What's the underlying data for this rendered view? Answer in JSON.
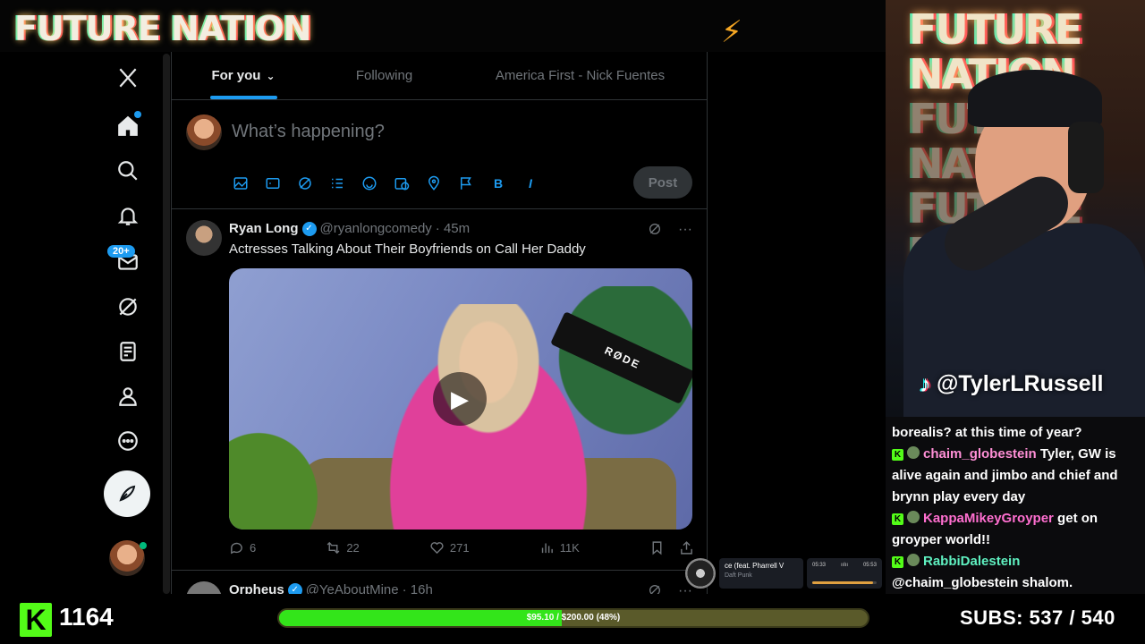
{
  "stream": {
    "brand": "FUTURE NATION",
    "webcam_bg_lines": [
      "FUTURE NATION",
      "FUTURE NATION",
      "FUTURE NATION"
    ],
    "tiktok_handle": "@TylerLRussell",
    "kick_logo": "K",
    "viewer_count": "1164",
    "goal_text": "$95.10 / $200.00 (48%)",
    "goal_progress": 0.48,
    "subs_text": "SUBS:  537 / 540"
  },
  "x_nav": {
    "badge_count": "20+"
  },
  "feed": {
    "tabs": [
      {
        "label": "For you",
        "active": true
      },
      {
        "label": "Following",
        "active": false
      },
      {
        "label": "America First - Nick Fuentes",
        "active": false
      }
    ],
    "composer": {
      "placeholder": "What’s happening?",
      "post_label": "Post",
      "tools": [
        "image",
        "GIF",
        "grok",
        "poll",
        "emoji",
        "schedule",
        "location",
        "flag",
        "B",
        "I"
      ]
    },
    "tweets": [
      {
        "name": "Ryan Long",
        "handle": "@ryanlongcomedy",
        "time": "· 45m",
        "text": "Actresses Talking About Their Boyfriends on Call Her Daddy",
        "media_mic_brand": "RØDE",
        "replies": "6",
        "reposts": "22",
        "likes": "271",
        "views": "11K"
      },
      {
        "name": "Orpheus",
        "handle": "@YeAboutMine",
        "time": "· 16h"
      }
    ]
  },
  "music": {
    "song": "ce (feat. Pharrell V",
    "artist": "Daft Punk",
    "elapsed": "05:33",
    "total": "05:53"
  },
  "chat": [
    {
      "user": "",
      "text": "borealis? at this time of year?"
    },
    {
      "user": "chaim_globestein",
      "text": " Tyler, GW is alive again and jimbo and chief and brynn play every day"
    },
    {
      "user": "KappaMikeyGroyper",
      "text": " get on groyper world!!"
    },
    {
      "user": "RabbiDalestein",
      "text": " @chaim_globestein shalom."
    }
  ],
  "colors": {
    "accent": "#1d9bf0",
    "kick_green": "#53fc18",
    "goal_fill": "#33e51a"
  }
}
